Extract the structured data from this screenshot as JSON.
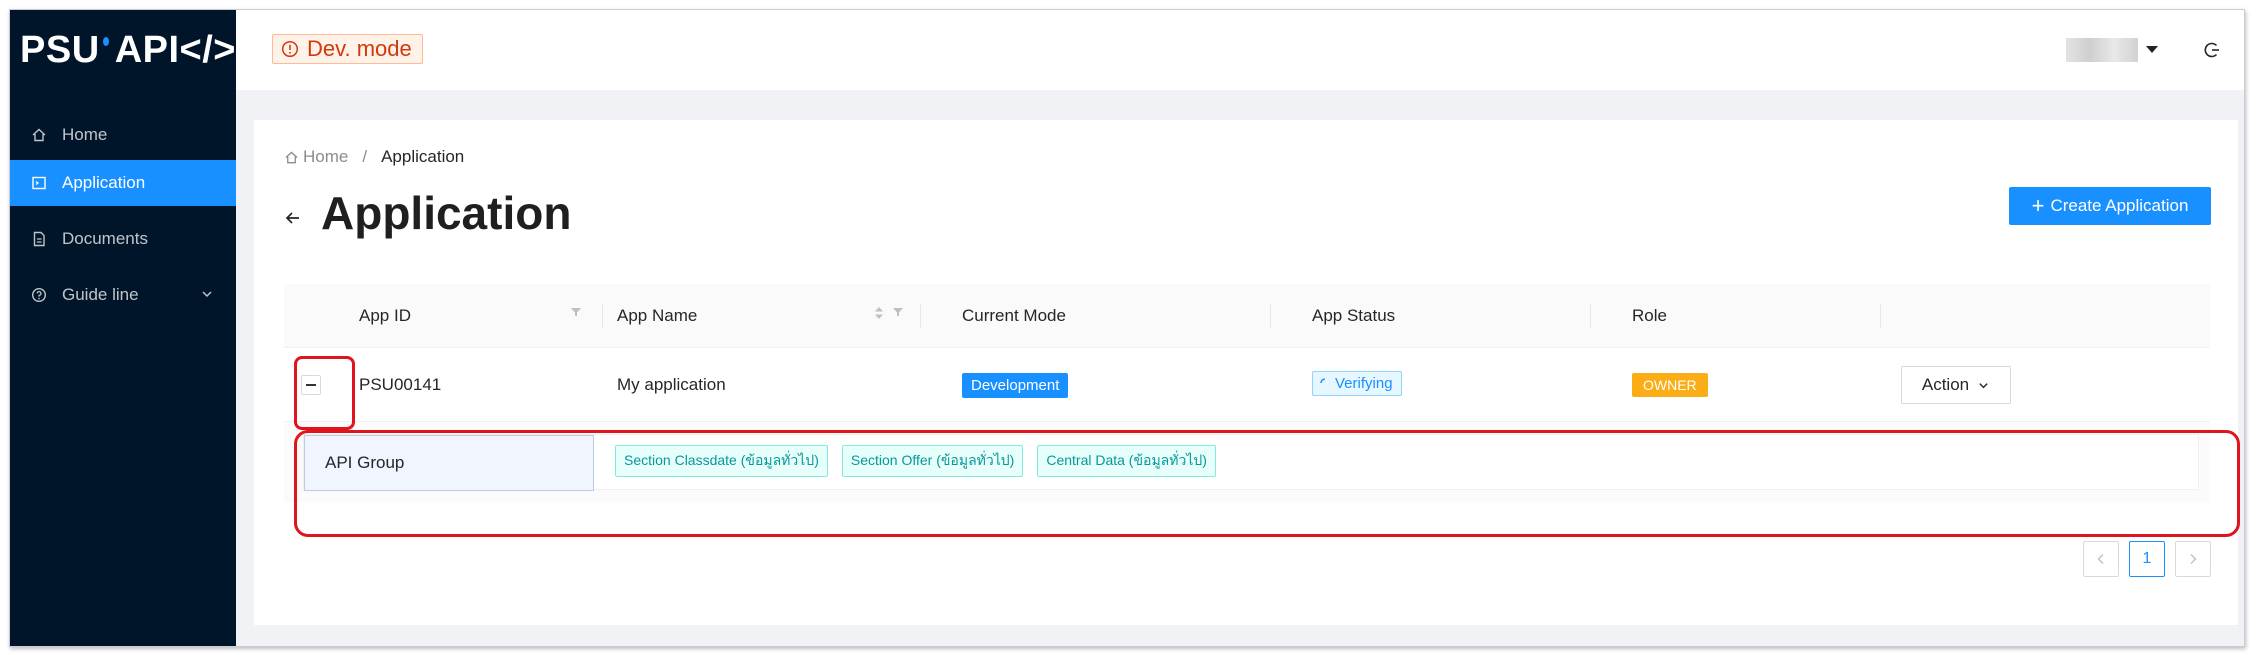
{
  "sidebar": {
    "logo_left": "PSU",
    "logo_right": "API</>",
    "items": [
      {
        "label": "Home",
        "icon": "home-icon"
      },
      {
        "label": "Application",
        "icon": "application-icon",
        "active": true
      },
      {
        "label": "Documents",
        "icon": "document-icon"
      },
      {
        "label": "Guide line",
        "icon": "question-circle-icon",
        "expandable": true
      }
    ]
  },
  "header": {
    "mode_badge": "Dev. mode"
  },
  "breadcrumb": {
    "home": "Home",
    "separator": "/",
    "current": "Application"
  },
  "page": {
    "title": "Application",
    "create_button": "Create Application"
  },
  "table": {
    "columns": [
      "App ID",
      "App Name",
      "Current Mode",
      "App Status",
      "Role"
    ],
    "rows": [
      {
        "app_id": "PSU00141",
        "app_name": "My application",
        "current_mode": "Development",
        "app_status": "Verifying",
        "role": "OWNER",
        "action": "Action"
      }
    ],
    "expanded": {
      "label": "API Group",
      "tags": [
        "Section Classdate (ข้อมูลทั่วไป)",
        "Section Offer (ข้อมูลทั่วไป)",
        "Central Data (ข้อมูลทั่วไป)"
      ]
    }
  },
  "pagination": {
    "current_page": "1"
  },
  "colors": {
    "sidebar_bg": "#001529",
    "primary": "#1890ff",
    "owner": "#faad14",
    "annotation": "#e0141e"
  }
}
